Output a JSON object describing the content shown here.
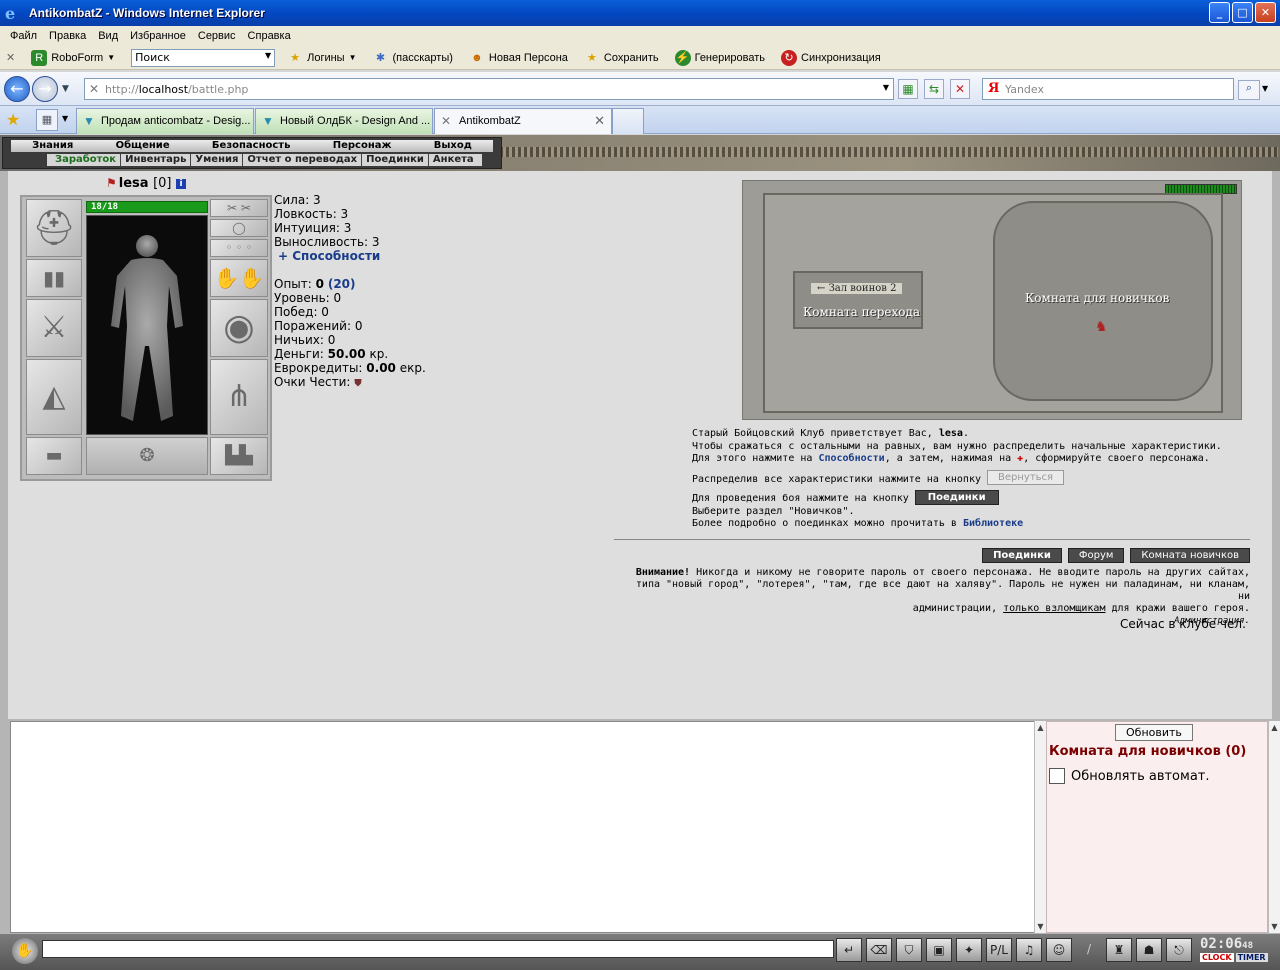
{
  "window": {
    "title": "AntikombatZ - Windows Internet Explorer"
  },
  "menubar": [
    "Файл",
    "Правка",
    "Вид",
    "Избранное",
    "Сервис",
    "Справка"
  ],
  "roboform": {
    "roboform_label": "RoboForm",
    "search_value": "Поиск",
    "logins": "Логины",
    "passcards": "(пасскарты)",
    "new_person": "Новая Персона",
    "save": "Сохранить",
    "generate": "Генерировать",
    "sync": "Синхронизация"
  },
  "address": {
    "prefix": "http://",
    "host": "localhost",
    "path": "/battle.php"
  },
  "search": {
    "placeholder": "Yandex",
    "logo": "Я"
  },
  "tabs": [
    {
      "label": "Продам anticombatz - Desig..."
    },
    {
      "label": "Новый ОлдБК - Design And ..."
    },
    {
      "label": "AntikombatZ"
    }
  ],
  "gamemenu": {
    "top": [
      "Знания",
      "Общение",
      "Безопасность",
      "Персонаж",
      "Выход"
    ],
    "sub": [
      "Заработок",
      "Инвентарь",
      "Умения",
      "Отчет о переводах",
      "Поединки",
      "Анкета"
    ]
  },
  "character": {
    "name": "lesa",
    "level": "[0]",
    "hp": "18/18",
    "stats": [
      {
        "label": "Сила: 3"
      },
      {
        "label": "Ловкость: 3"
      },
      {
        "label": "Интуиция: 3"
      },
      {
        "label": "Выносливость: 3"
      }
    ],
    "abilities_link": "+ Способности",
    "exp_label": "Опыт:",
    "exp_value": "0",
    "exp_next": "(20)",
    "level_line": "Уровень: 0",
    "wins": "Побед: 0",
    "losses": "Поражений: 0",
    "draws": "Ничьих: 0",
    "money_label": "Деньги:",
    "money_value": "50.00",
    "money_unit": "кр.",
    "euro_label": "Еврокредиты:",
    "euro_value": "0.00",
    "euro_unit": "екр.",
    "honor": "Очки Чести:"
  },
  "map": {
    "room1": "Зал воинов 2",
    "room2": "Комната перехода",
    "room3": "Комната для новичков"
  },
  "welcome": {
    "l1a": "Старый Бойцовский Клуб приветствует Вас,",
    "l1b": "lesa",
    "l2": "Чтобы сражаться с остальными на равных, вам нужно распределить начальные характеристики.",
    "l3a": "Для этого нажмите на",
    "l3b": "Способности",
    "l3c": ", а затем, нажимая на",
    "l3d": ", сформируйте своего персонажа.",
    "l4": "Распределив все характеристики нажмите на кнопку",
    "return_btn": "Вернуться",
    "l5": "Для проведения боя нажмите на кнопку",
    "fights_btn": "Поединки",
    "l6": "Выберите раздел \"Новичков\".",
    "l7a": "Более подробно о поединках можно прочитать в",
    "l7b": "Библиотеке"
  },
  "buttons": {
    "fights": "Поединки",
    "forum": "Форум",
    "room": "Комната новичков"
  },
  "warning": {
    "title": "Внимание!",
    "text1": "Никогда и никому не говорите пароль от своего персонажа. Не вводите пароль на других сайтах,",
    "text2": "типа \"новый город\", \"лотерея\", \"там, где все дают на халяву\". Пароль не нужен ни паладинам, ни кланам, ни",
    "text3a": "администрации,",
    "text3b": "только взломщикам",
    "text3c": "для кражи вашего героя.",
    "signature": "Администрация."
  },
  "online": "Сейчас в клубе чел.",
  "room_panel": {
    "refresh": "Обновить",
    "title": "Комната для новичков (0)",
    "auto": "Обновлять автомат."
  },
  "clock": {
    "time": "02:06",
    "sec": "48",
    "clock_label": "CLOCK",
    "timer_label": "TIMER"
  }
}
